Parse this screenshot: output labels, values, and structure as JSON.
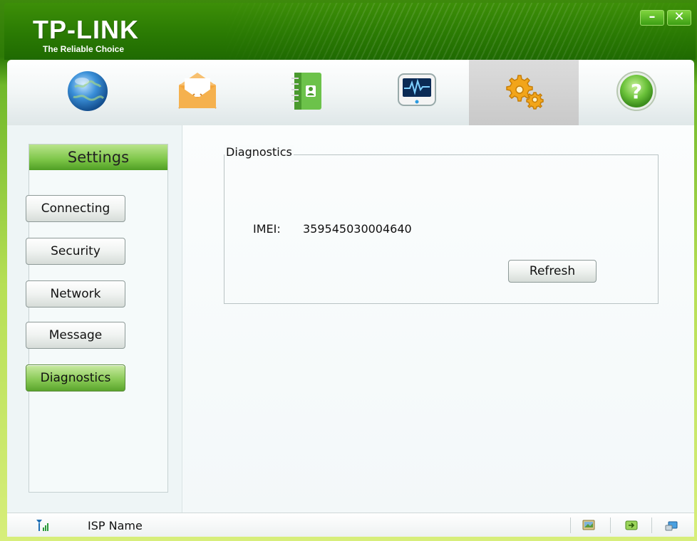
{
  "app": {
    "brand": "TP-LINK",
    "tagline": "The Reliable Choice",
    "minimize_glyph": "–",
    "close_glyph": "✕"
  },
  "toolbar": {
    "items": [
      {
        "icon": "globe-icon"
      },
      {
        "icon": "envelope-icon"
      },
      {
        "icon": "contacts-book-icon"
      },
      {
        "icon": "monitor-statistics-icon"
      },
      {
        "icon": "gears-settings-icon",
        "active": true
      },
      {
        "icon": "help-icon",
        "glyph": "?"
      }
    ]
  },
  "sidebar": {
    "header": "Settings",
    "items": [
      {
        "label": "Connecting"
      },
      {
        "label": "Security"
      },
      {
        "label": "Network"
      },
      {
        "label": "Message"
      },
      {
        "label": "Diagnostics",
        "active": true
      }
    ]
  },
  "diagnostics": {
    "group_title": "Diagnostics",
    "imei_label": "IMEI:",
    "imei_value": "359545030004640",
    "refresh_label": "Refresh"
  },
  "statusbar": {
    "isp_name": "ISP Name",
    "icons": [
      "signal-strength-icon",
      "sms-image-icon",
      "connection-icon",
      "usb-device-icon"
    ]
  },
  "colors": {
    "brand_green": "#2a7a03",
    "active_green": "#8bcb58"
  }
}
